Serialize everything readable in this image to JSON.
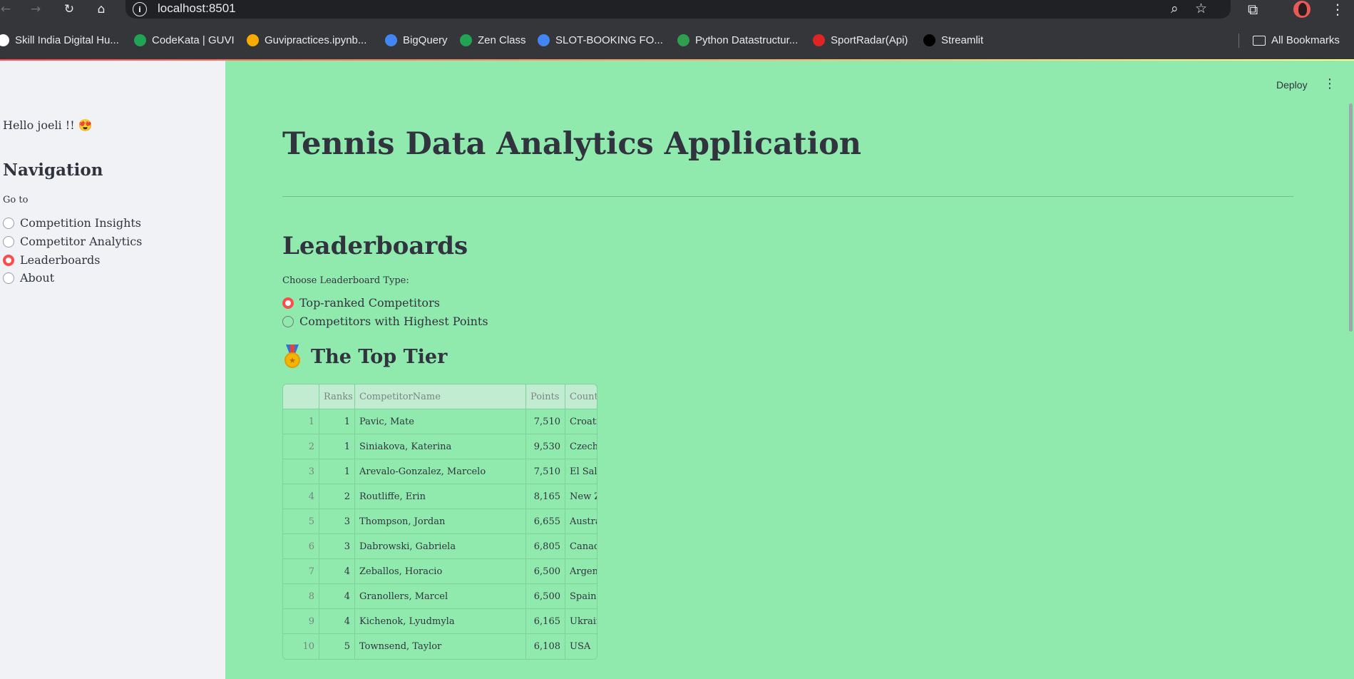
{
  "browser": {
    "url": "localhost:8501",
    "bookmarks": [
      {
        "label": "Skill India Digital Hu...",
        "icon": "skill-india-icon",
        "color": "#ffffff"
      },
      {
        "label": "CodeKata | GUVI",
        "icon": "guvi-icon",
        "color": "#21a453"
      },
      {
        "label": "Guvipractices.ipynb...",
        "icon": "colab-icon",
        "color": "#f9ab00"
      },
      {
        "label": "BigQuery",
        "icon": "bigquery-icon",
        "color": "#4285f4"
      },
      {
        "label": "Zen Class",
        "icon": "guvi-icon",
        "color": "#21a453"
      },
      {
        "label": "SLOT-BOOKING FO...",
        "icon": "google-docs-icon",
        "color": "#4285f4"
      },
      {
        "label": "Python Datastructur...",
        "icon": "python-ds-icon",
        "color": "#2e9e4f"
      },
      {
        "label": "SportRadar(Api)",
        "icon": "sportradar-icon",
        "color": "#e02424"
      },
      {
        "label": "Streamlit",
        "icon": "medium-icon",
        "color": "#000000"
      }
    ],
    "all_bookmarks": "All Bookmarks"
  },
  "sidebar": {
    "greeting": "Hello joeli !! 😍",
    "title": "Navigation",
    "goto_label": "Go to",
    "options": [
      {
        "label": "Competition Insights",
        "selected": false
      },
      {
        "label": "Competitor Analytics",
        "selected": false
      },
      {
        "label": "Leaderboards",
        "selected": true
      },
      {
        "label": "About",
        "selected": false
      }
    ]
  },
  "header": {
    "deploy_label": "Deploy"
  },
  "main": {
    "title": "Tennis Data Analytics Application",
    "section_title": "Leaderboards",
    "choose_label": "Choose Leaderboard Type:",
    "leaderboard_options": [
      {
        "label": "Top-ranked Competitors",
        "selected": true
      },
      {
        "label": "Competitors with Highest Points",
        "selected": false
      }
    ],
    "subheader": "The Top Tier",
    "subheader_icon": "medal-icon"
  },
  "table": {
    "columns": [
      "",
      "Ranks",
      "CompetitorName",
      "Points",
      "Country"
    ],
    "rows": [
      {
        "index": "1",
        "rank": "1",
        "name": "Pavic, Mate",
        "points": "7,510",
        "country": "Croatia"
      },
      {
        "index": "2",
        "rank": "1",
        "name": "Siniakova, Katerina",
        "points": "9,530",
        "country": "Czechia"
      },
      {
        "index": "3",
        "rank": "1",
        "name": "Arevalo-Gonzalez, Marcelo",
        "points": "7,510",
        "country": "El Salvador"
      },
      {
        "index": "4",
        "rank": "2",
        "name": "Routliffe, Erin",
        "points": "8,165",
        "country": "New Zealand"
      },
      {
        "index": "5",
        "rank": "3",
        "name": "Thompson, Jordan",
        "points": "6,655",
        "country": "Australia"
      },
      {
        "index": "6",
        "rank": "3",
        "name": "Dabrowski, Gabriela",
        "points": "6,805",
        "country": "Canada"
      },
      {
        "index": "7",
        "rank": "4",
        "name": "Zeballos, Horacio",
        "points": "6,500",
        "country": "Argentina"
      },
      {
        "index": "8",
        "rank": "4",
        "name": "Granollers, Marcel",
        "points": "6,500",
        "country": "Spain"
      },
      {
        "index": "9",
        "rank": "4",
        "name": "Kichenok, Lyudmyla",
        "points": "6,165",
        "country": "Ukraine"
      },
      {
        "index": "10",
        "rank": "5",
        "name": "Townsend, Taylor",
        "points": "6,108",
        "country": "USA"
      }
    ]
  },
  "colors": {
    "main_background": "#90eaad",
    "sidebar_background": "#f0f2f6",
    "accent": "#ff4b4b",
    "text": "#31333f"
  }
}
